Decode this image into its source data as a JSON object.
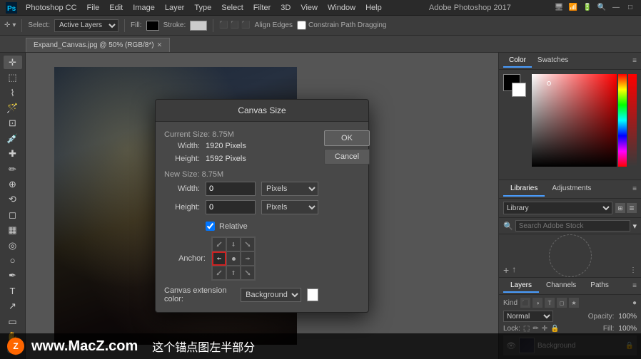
{
  "app": {
    "title": "Adobe Photoshop 2017",
    "tab_label": "Expand_Canvas.jpg @ 50% (RGB/8*)"
  },
  "menu": {
    "items": [
      "Photoshop CC",
      "File",
      "Edit",
      "Image",
      "Layer",
      "Type",
      "Select",
      "Filter",
      "3D",
      "View",
      "Window",
      "Help"
    ]
  },
  "toolbar": {
    "select_label": "Select:",
    "layers_option": "Active Layers",
    "fill_label": "Fill:",
    "stroke_label": "Stroke:",
    "align_edges": "Align Edges",
    "constrain": "Constrain Path Dragging"
  },
  "dialog": {
    "title": "Canvas Size",
    "current_size_label": "Current Size: 8.75M",
    "width_label": "Width:",
    "width_value": "1920 Pixels",
    "height_label": "Height:",
    "height_value": "1592 Pixels",
    "new_size_label": "New Size: 8.75M",
    "new_width_label": "Width:",
    "new_width_value": "0",
    "new_height_label": "Height:",
    "new_height_value": "0",
    "pixels_option": "Pixels",
    "relative_label": "Relative",
    "anchor_label": "Anchor:",
    "canvas_ext_label": "Canvas extension color:",
    "canvas_ext_value": "Background",
    "ok_label": "OK",
    "cancel_label": "Cancel"
  },
  "right_panel": {
    "color_tab": "Color",
    "swatches_tab": "Swatches",
    "libraries_tab": "Libraries",
    "adjustments_tab": "Adjustments",
    "library_select": "Library",
    "search_placeholder": "Search Adobe Stock",
    "layers_tab": "Layers",
    "channels_tab": "Channels",
    "paths_tab": "Paths",
    "kind_label": "Kind",
    "normal_label": "Normal",
    "opacity_label": "Opacity:",
    "opacity_value": "100%",
    "lock_label": "Lock:",
    "fill_label": "Fill:",
    "fill_value": "100%",
    "layer_name": "Background"
  },
  "watermark": {
    "logo": "Z",
    "url": "www.MacZ.com",
    "description": "这个锚点图左半部分"
  }
}
